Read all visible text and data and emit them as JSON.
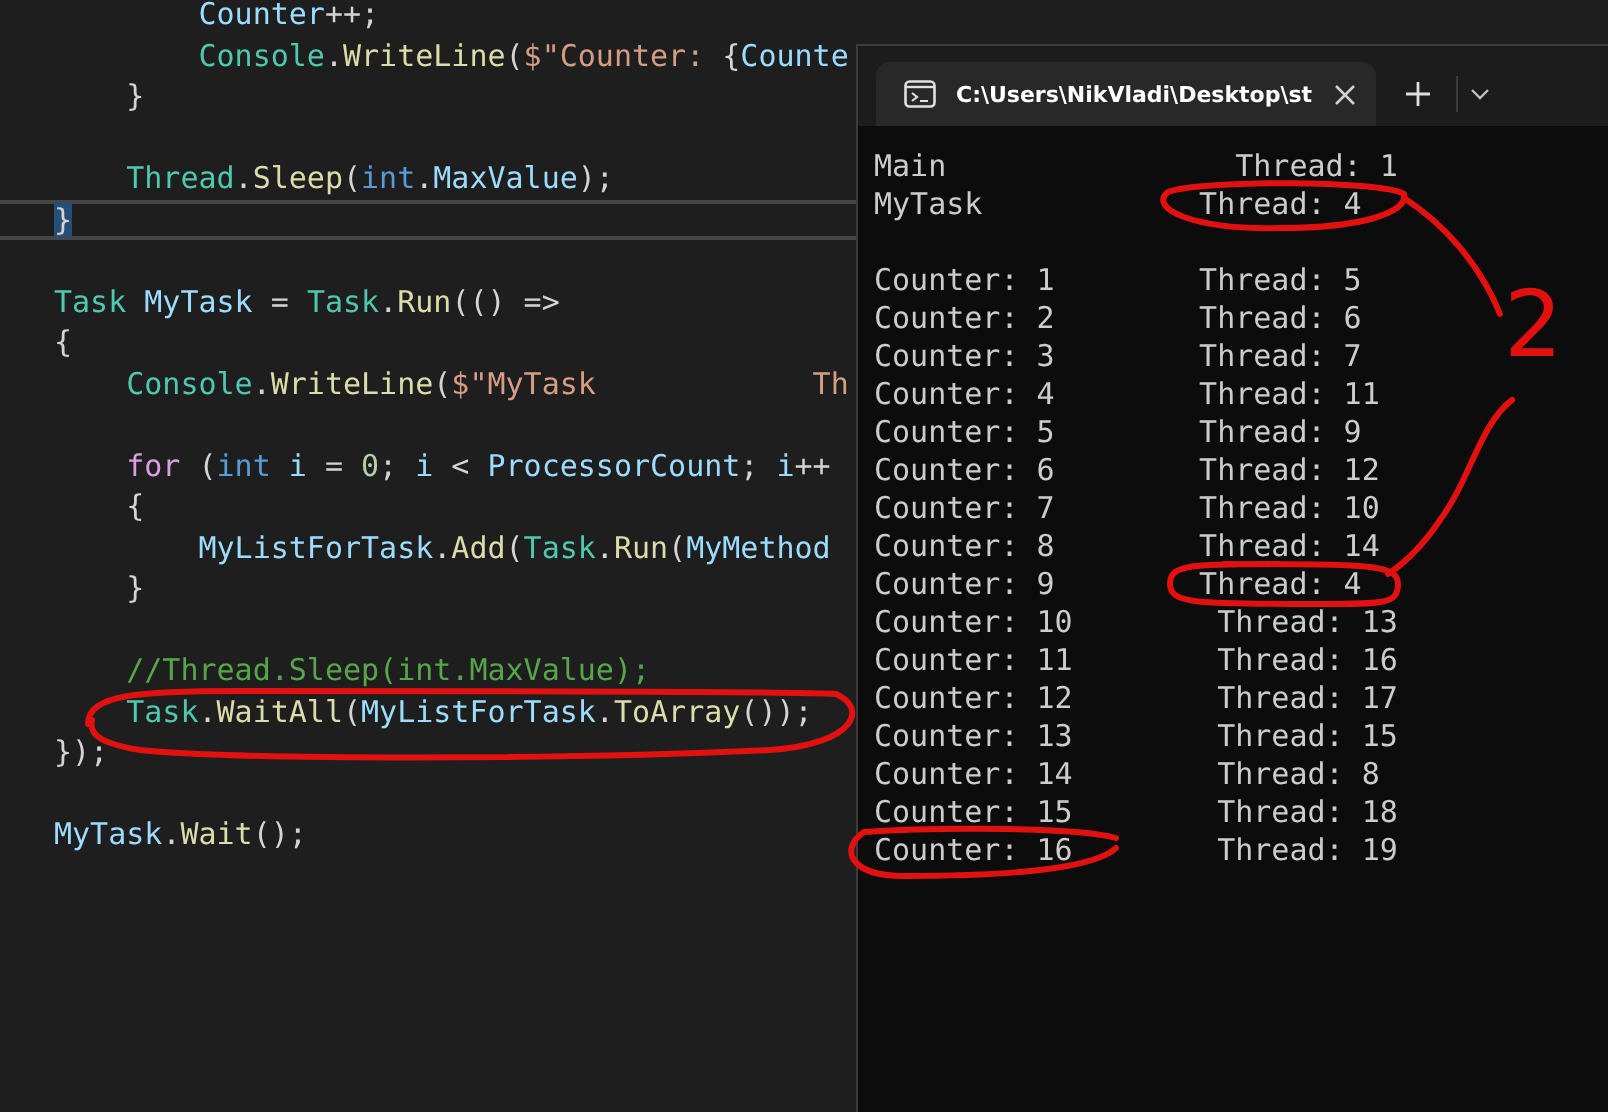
{
  "editor": {
    "blocks": [
      [
        {
          "tokens": [
            {
              "kind": "variable",
              "text": "        Counter"
            },
            {
              "kind": "plain",
              "text": "++;"
            }
          ]
        },
        {
          "tokens": [
            {
              "kind": "type",
              "text": "        Console"
            },
            {
              "kind": "plain",
              "text": "."
            },
            {
              "kind": "method",
              "text": "WriteLine"
            },
            {
              "kind": "plain",
              "text": "("
            },
            {
              "kind": "string",
              "text": "$\"Counter: "
            },
            {
              "kind": "plain",
              "text": "{"
            },
            {
              "kind": "variable",
              "text": "Counte"
            }
          ]
        },
        {
          "tokens": [
            {
              "kind": "plain",
              "text": "    }"
            }
          ]
        }
      ],
      [
        {
          "tokens": [
            {
              "kind": "type",
              "text": "    Thread"
            },
            {
              "kind": "plain",
              "text": "."
            },
            {
              "kind": "method",
              "text": "Sleep"
            },
            {
              "kind": "plain",
              "text": "("
            },
            {
              "kind": "keyword",
              "text": "int"
            },
            {
              "kind": "plain",
              "text": "."
            },
            {
              "kind": "variable",
              "text": "MaxValue"
            },
            {
              "kind": "plain",
              "text": ");"
            }
          ]
        },
        {
          "tokens": [
            {
              "kind": "match",
              "text": "}"
            }
          ]
        }
      ],
      [
        {
          "tokens": [
            {
              "kind": "type",
              "text": "Task "
            },
            {
              "kind": "variable",
              "text": "MyTask"
            },
            {
              "kind": "plain",
              "text": " = "
            },
            {
              "kind": "type",
              "text": "Task"
            },
            {
              "kind": "plain",
              "text": "."
            },
            {
              "kind": "method",
              "text": "Run"
            },
            {
              "kind": "plain",
              "text": "(() =>"
            }
          ]
        },
        {
          "tokens": [
            {
              "kind": "plain",
              "text": "{"
            }
          ]
        },
        {
          "tokens": [
            {
              "kind": "type",
              "text": "    Console"
            },
            {
              "kind": "plain",
              "text": "."
            },
            {
              "kind": "method",
              "text": "WriteLine"
            },
            {
              "kind": "plain",
              "text": "("
            },
            {
              "kind": "string",
              "text": "$\"MyTask            Th"
            }
          ]
        }
      ],
      [
        {
          "tokens": [
            {
              "kind": "control",
              "text": "    for"
            },
            {
              "kind": "plain",
              "text": " ("
            },
            {
              "kind": "keyword",
              "text": "int "
            },
            {
              "kind": "variable",
              "text": "i"
            },
            {
              "kind": "plain",
              "text": " = "
            },
            {
              "kind": "number",
              "text": "0"
            },
            {
              "kind": "plain",
              "text": "; "
            },
            {
              "kind": "variable",
              "text": "i"
            },
            {
              "kind": "plain",
              "text": " < "
            },
            {
              "kind": "variable",
              "text": "ProcessorCount"
            },
            {
              "kind": "plain",
              "text": "; "
            },
            {
              "kind": "variable",
              "text": "i"
            },
            {
              "kind": "plain",
              "text": "++"
            }
          ]
        },
        {
          "tokens": [
            {
              "kind": "plain",
              "text": "    {"
            }
          ]
        },
        {
          "tokens": [
            {
              "kind": "variable",
              "text": "        MyListForTask"
            },
            {
              "kind": "plain",
              "text": "."
            },
            {
              "kind": "method",
              "text": "Add"
            },
            {
              "kind": "plain",
              "text": "("
            },
            {
              "kind": "type",
              "text": "Task"
            },
            {
              "kind": "plain",
              "text": "."
            },
            {
              "kind": "method",
              "text": "Run"
            },
            {
              "kind": "plain",
              "text": "("
            },
            {
              "kind": "variable",
              "text": "MyMethod"
            }
          ]
        },
        {
          "tokens": [
            {
              "kind": "plain",
              "text": "    }"
            }
          ]
        }
      ],
      [
        {
          "tokens": [
            {
              "kind": "comment",
              "text": "    //Thread.Sleep(int.MaxValue);"
            }
          ]
        },
        {
          "tokens": [
            {
              "kind": "type",
              "text": "    Task"
            },
            {
              "kind": "plain",
              "text": "."
            },
            {
              "kind": "method",
              "text": "WaitAll"
            },
            {
              "kind": "plain",
              "text": "("
            },
            {
              "kind": "variable",
              "text": "MyListForTask"
            },
            {
              "kind": "plain",
              "text": "."
            },
            {
              "kind": "method",
              "text": "ToArray"
            },
            {
              "kind": "plain",
              "text": "());"
            }
          ]
        },
        {
          "tokens": [
            {
              "kind": "plain",
              "text": "});"
            }
          ]
        }
      ],
      [
        {
          "tokens": [
            {
              "kind": "variable",
              "text": "MyTask"
            },
            {
              "kind": "plain",
              "text": "."
            },
            {
              "kind": "method",
              "text": "Wait"
            },
            {
              "kind": "plain",
              "text": "();"
            }
          ]
        }
      ]
    ]
  },
  "terminal": {
    "tab": {
      "title": "C:\\Users\\NikVladi\\Desktop\\st",
      "selected": true
    },
    "header": [
      {
        "name": "Main",
        "thread": "Thread: 1"
      },
      {
        "name": "MyTask",
        "thread": "Thread: 4"
      }
    ],
    "counters": [
      {
        "counter": "Counter: 1",
        "thread": "Thread: 5"
      },
      {
        "counter": "Counter: 2",
        "thread": "Thread: 6"
      },
      {
        "counter": "Counter: 3",
        "thread": "Thread: 7"
      },
      {
        "counter": "Counter: 4",
        "thread": "Thread: 11"
      },
      {
        "counter": "Counter: 5",
        "thread": "Thread: 9"
      },
      {
        "counter": "Counter: 6",
        "thread": "Thread: 12"
      },
      {
        "counter": "Counter: 7",
        "thread": "Thread: 10"
      },
      {
        "counter": "Counter: 8",
        "thread": "Thread: 14"
      },
      {
        "counter": "Counter: 9",
        "thread": "Thread: 4"
      },
      {
        "counter": "Counter: 10",
        "thread": "Thread: 13"
      },
      {
        "counter": "Counter: 11",
        "thread": "Thread: 16"
      },
      {
        "counter": "Counter: 12",
        "thread": "Thread: 17"
      },
      {
        "counter": "Counter: 13",
        "thread": "Thread: 15"
      },
      {
        "counter": "Counter: 14",
        "thread": "Thread: 8"
      },
      {
        "counter": "Counter: 15",
        "thread": "Thread: 18"
      },
      {
        "counter": "Counter: 16",
        "thread": "Thread: 19"
      }
    ]
  },
  "annotations": [
    {
      "kind": "ellipse"
    },
    {
      "kind": "ellipse"
    },
    {
      "kind": "ellipse"
    },
    {
      "kind": "box"
    },
    {
      "kind": "line"
    },
    {
      "kind": "line"
    },
    {
      "kind": "label",
      "text": "2"
    }
  ]
}
